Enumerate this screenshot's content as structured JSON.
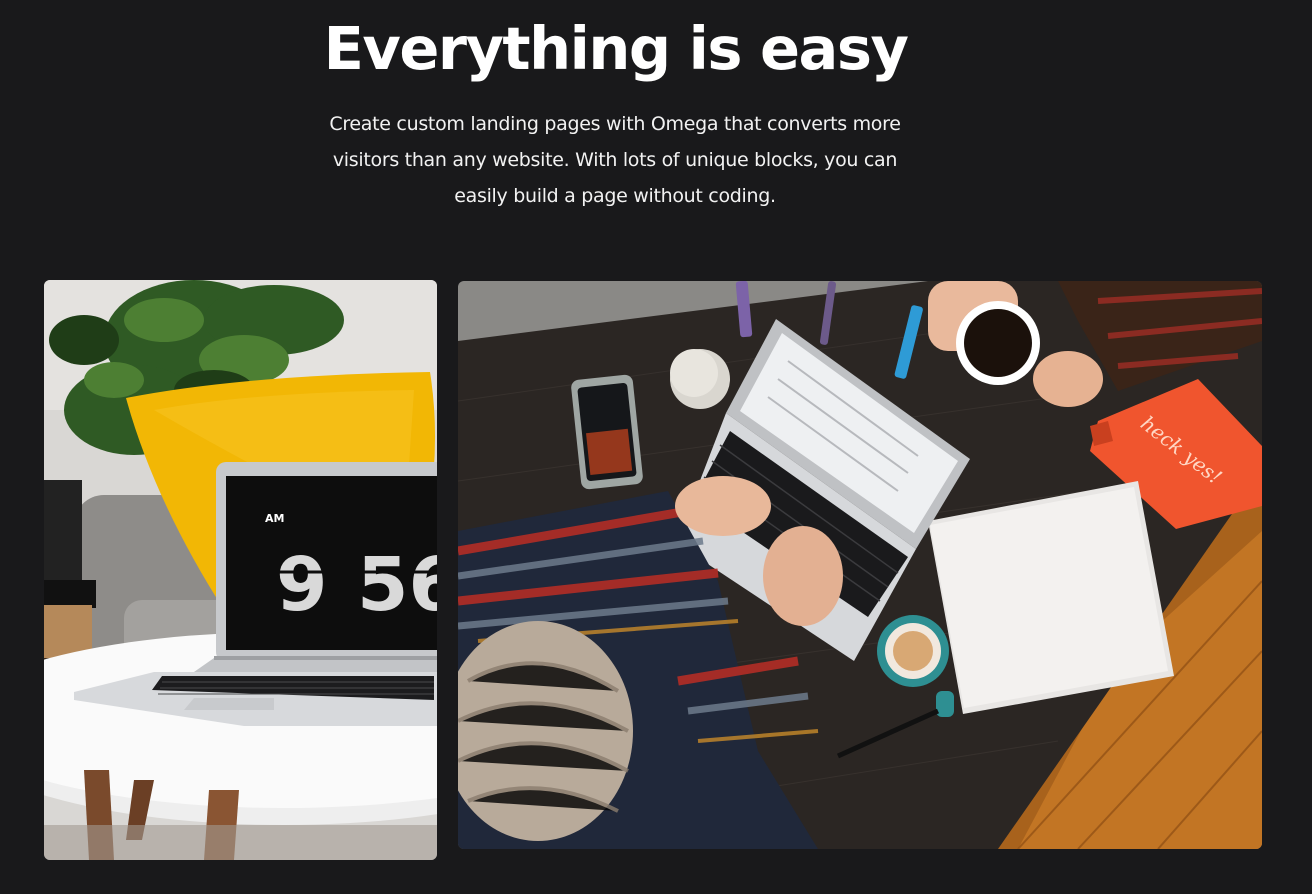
{
  "section": {
    "title": "Everything is easy",
    "description": "Create custom landing pages with Omega that converts more visitors than any website. With lots of unique blocks, you can easily build a page without coding."
  },
  "gallery": {
    "left_image": {
      "clock_am": "AM",
      "clock_hour": "9",
      "clock_minutes": "56"
    },
    "right_image": {
      "pouch_text": "heck yes!"
    }
  },
  "colors": {
    "background": "#19191b",
    "text": "#ffffff",
    "pillow": "#f2b705",
    "pouch": "#f0552e"
  }
}
